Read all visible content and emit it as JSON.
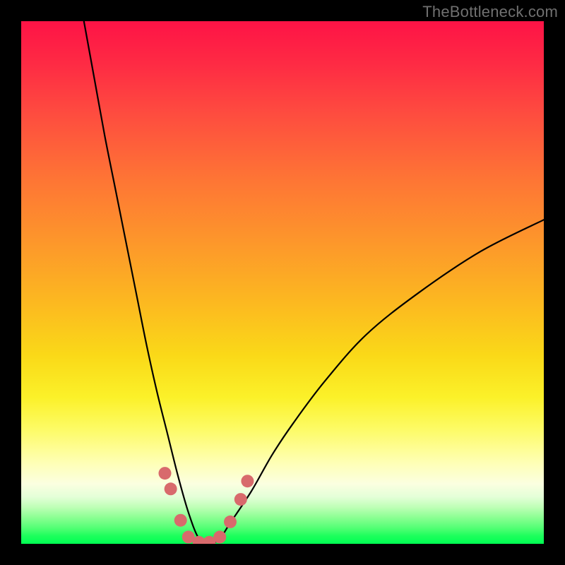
{
  "watermark": "TheBottleneck.com",
  "chart_data": {
    "type": "line",
    "title": "",
    "xlabel": "",
    "ylabel": "",
    "x_range": [
      0,
      100
    ],
    "y_range": [
      0,
      100
    ],
    "description": "Bottleneck curve — V-shaped black curve over vertical red-to-green gradient. Minimum (optimal / no bottleneck, green zone) occurs near x≈33–37 at y≈0; both arms rise steeply into the red (high bottleneck) region, left arm reaching y≈100 near x≈12, right arm reaching y≈62 at x=100.",
    "series": [
      {
        "name": "bottleneck-curve",
        "x": [
          12,
          14,
          16,
          18,
          20,
          22,
          24,
          26,
          28,
          30,
          32,
          34,
          36,
          38,
          40,
          44,
          48,
          52,
          58,
          66,
          76,
          88,
          100
        ],
        "y": [
          100,
          89,
          78,
          68,
          58,
          48,
          38,
          29,
          21,
          13,
          6,
          1,
          0,
          1,
          4,
          10,
          17,
          23,
          31,
          40,
          48,
          56,
          62
        ]
      }
    ],
    "markers": {
      "name": "highlight-dots",
      "color": "#d86a6c",
      "points": [
        {
          "x": 27.5,
          "y": 13.5
        },
        {
          "x": 28.6,
          "y": 10.5
        },
        {
          "x": 30.5,
          "y": 4.5
        },
        {
          "x": 32.0,
          "y": 1.3
        },
        {
          "x": 34.0,
          "y": 0.3
        },
        {
          "x": 36.0,
          "y": 0.3
        },
        {
          "x": 38.0,
          "y": 1.3
        },
        {
          "x": 40.0,
          "y": 4.2
        },
        {
          "x": 42.0,
          "y": 8.5
        },
        {
          "x": 43.3,
          "y": 12.0
        }
      ]
    },
    "gradient_scale": {
      "orientation": "vertical",
      "top_meaning": "high bottleneck (red)",
      "bottom_meaning": "no bottleneck (green)"
    }
  }
}
